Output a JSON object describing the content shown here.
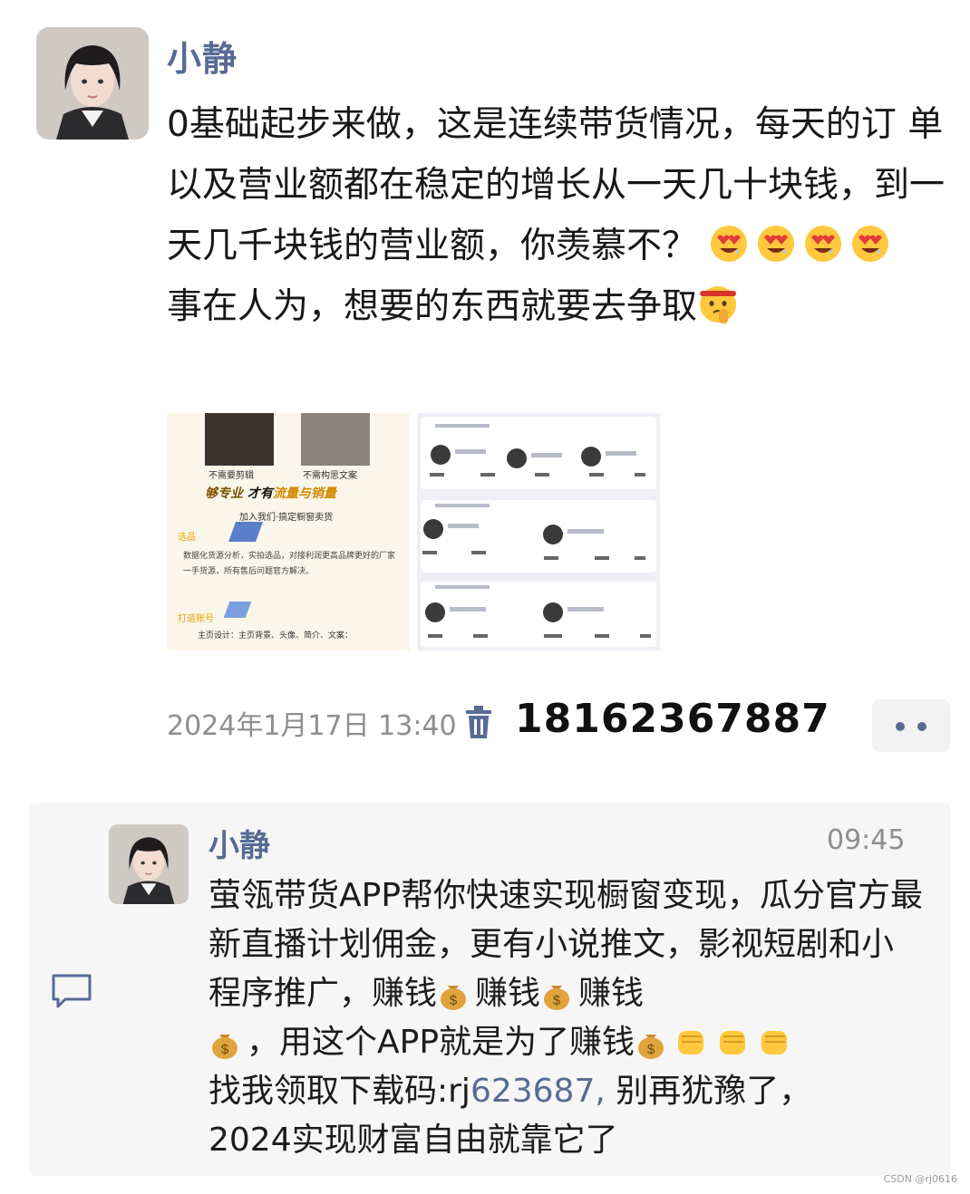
{
  "post": {
    "author": "小静",
    "text_lines": [
      "0基础起步来做，这是连续带货情况，每天的订 单以及营业额都在稳定的增长从一天几十块钱，到一天几千块钱的营业额，你羡慕不？",
      "事在人为，想要的东西就要去争取"
    ],
    "emojis_after_line1": [
      "heart-eyes-emoji",
      "heart-eyes-emoji",
      "heart-eyes-emoji",
      "heart-eyes-emoji"
    ],
    "emoji_after_line2": "shushing-face-emoji",
    "images": [
      {
        "captions": [
          "不需要剪辑",
          "不需构思文案"
        ],
        "headline_a": "够专业",
        "headline_b": "才有",
        "headline_c": "流量与销量",
        "subline": "加入我们·搞定橱窗卖货",
        "section1_title": "选品",
        "section1_body": "数据化货源分析，实拍选品，对接利润更高品牌更好的厂家一手货源，所有售后问题官方解决。",
        "section2_title": "打造账号",
        "section2_body": "主页设计：主页背景、头像、简介、文案："
      },
      {
        "desc": "多个账号收益截图"
      }
    ],
    "timestamp": "2024年1月17日 13:40",
    "phone": "18162367887"
  },
  "comment": {
    "author": "小静",
    "time": "09:45",
    "line1": "萤瓴带货APP帮你快速实现橱窗变现，瓜分官方最新直播计划佣金，更有小说推文，影视短剧和小程序推广，赚钱",
    "line1b": "赚钱",
    "line1c": "赚钱",
    "line2": "，用这个APP就是为了赚钱",
    "line3_prefix": "找我领取下载码:rj",
    "line3_code": "623687,",
    "line3_suffix": " 别再犹豫了，",
    "line4": "2024实现财富自由就靠它了"
  },
  "watermark": "CSDN @rj0616",
  "colors": {
    "link": "#576b95",
    "meta": "#8e8e8e",
    "comment_bg": "#f6f6f6"
  }
}
